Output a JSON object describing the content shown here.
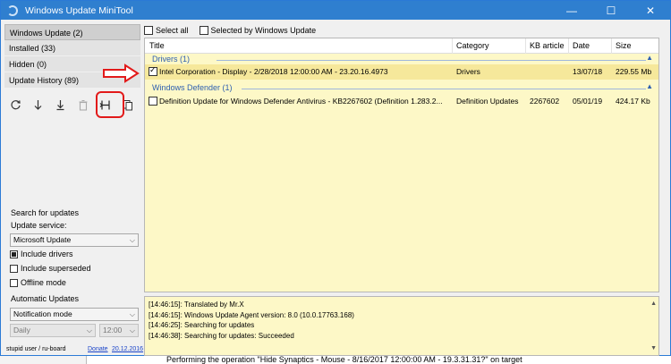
{
  "window": {
    "title": "Windows Update MiniTool",
    "controls": {
      "minimize": "—",
      "maximize": "☐",
      "close": "✕"
    }
  },
  "nav": [
    {
      "label": "Windows Update (2)"
    },
    {
      "label": "Installed (33)"
    },
    {
      "label": "Hidden (0)"
    },
    {
      "label": "Update History (89)"
    }
  ],
  "toolbar": {
    "icons": [
      "refresh-icon",
      "download-icon",
      "install-icon",
      "delete-icon",
      "hide-icon",
      "copy-icon"
    ],
    "glyphs": [
      "↻",
      "↓",
      "⤓",
      "🗑",
      "↕↔",
      "⎘"
    ]
  },
  "search": {
    "heading": "Search for updates",
    "service_label": "Update service:",
    "service_value": "Microsoft Update",
    "include_drivers": "Include drivers",
    "include_superseded": "Include superseded",
    "offline_mode": "Offline mode"
  },
  "auto_updates": {
    "heading": "Automatic Updates",
    "mode_value": "Notification mode",
    "day_value": "Daily",
    "time_value": "12:00"
  },
  "footer": {
    "left": "stupid user / ru-board",
    "donate": "Donate",
    "date": "20.12.2016"
  },
  "topbar": {
    "select_all": "Select all",
    "selected_by_wu": "Selected by Windows Update"
  },
  "table": {
    "headers": [
      "Title",
      "Category",
      "KB article",
      "Date",
      "Size"
    ],
    "groups": [
      {
        "name": "Drivers (1)",
        "rows": [
          {
            "checked": true,
            "title": "Intel Corporation - Display - 2/28/2018 12:00:00 AM - 23.20.16.4973",
            "category": "Drivers",
            "kb": "",
            "date": "13/07/18",
            "size": "229.55 Mb"
          }
        ]
      },
      {
        "name": "Windows Defender (1)",
        "rows": [
          {
            "checked": false,
            "title": "Definition Update for Windows Defender Antivirus - KB2267602 (Definition 1.283.2...",
            "category": "Definition Updates",
            "kb": "2267602",
            "date": "05/01/19",
            "size": "424.17 Kb"
          }
        ]
      }
    ]
  },
  "log": [
    "[14:46:15]: Translated by Mr.X",
    "[14:46:15]: Windows Update Agent version: 8.0 (10.0.17763.168)",
    "[14:46:25]: Searching for updates",
    "[14:46:38]: Searching for updates: Succeeded"
  ],
  "status_strip": "Performing the operation \"Hide Synaptics - Mouse - 8/16/2017 12:00:00 AM - 19.3.31.31?\" on target",
  "colors": {
    "titlebar": "#2f7fcf",
    "list_bg": "#fdf8c7",
    "selected_row": "#f6e89b",
    "group_text": "#2e5fb0",
    "annotation": "#e21a1a"
  }
}
